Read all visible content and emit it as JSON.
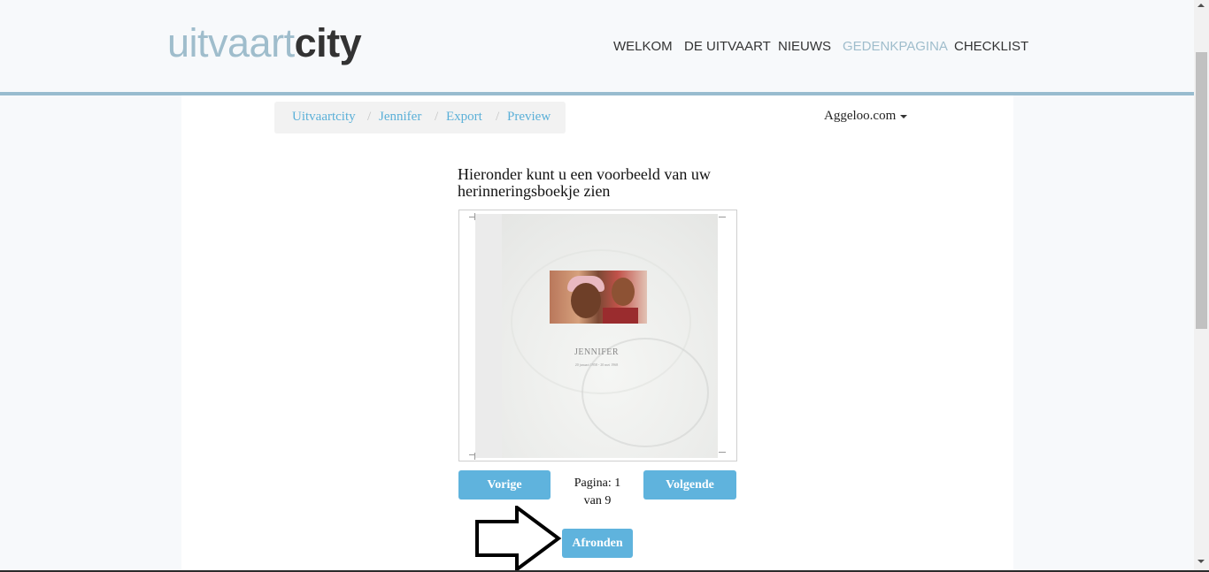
{
  "header": {
    "logo": {
      "part1": "uitvaart",
      "part2": "city"
    },
    "nav": [
      {
        "label": "WELKOM",
        "active": false
      },
      {
        "label": "DE UITVAART",
        "active": false
      },
      {
        "label": "NIEUWS",
        "active": false
      },
      {
        "label": "GEDENKPAGINA",
        "active": true
      },
      {
        "label": "CHECKLIST",
        "active": false
      }
    ]
  },
  "breadcrumb": [
    "Uitvaartcity",
    "Jennifer",
    "Export",
    "Preview"
  ],
  "account": {
    "label": "Aggeloo.com"
  },
  "main": {
    "intro": "Hieronder kunt u een voorbeeld van uw herinneringsboekje zien",
    "preview": {
      "name": "JENNIFER",
      "dates": "20 januari 1958 - 20 mei 1968"
    },
    "pager": {
      "prev_label": "Vorige",
      "next_label": "Volgende",
      "page_text_1": "Pagina: 1",
      "page_text_2": "van 9",
      "current": 1,
      "total": 9
    },
    "finish_label": "Afronden"
  },
  "colors": {
    "accent": "#5fb3dd",
    "logo_light": "#9fbdcc",
    "header_border": "#98bccf",
    "breadcrumb_link": "#5bb0d8"
  }
}
